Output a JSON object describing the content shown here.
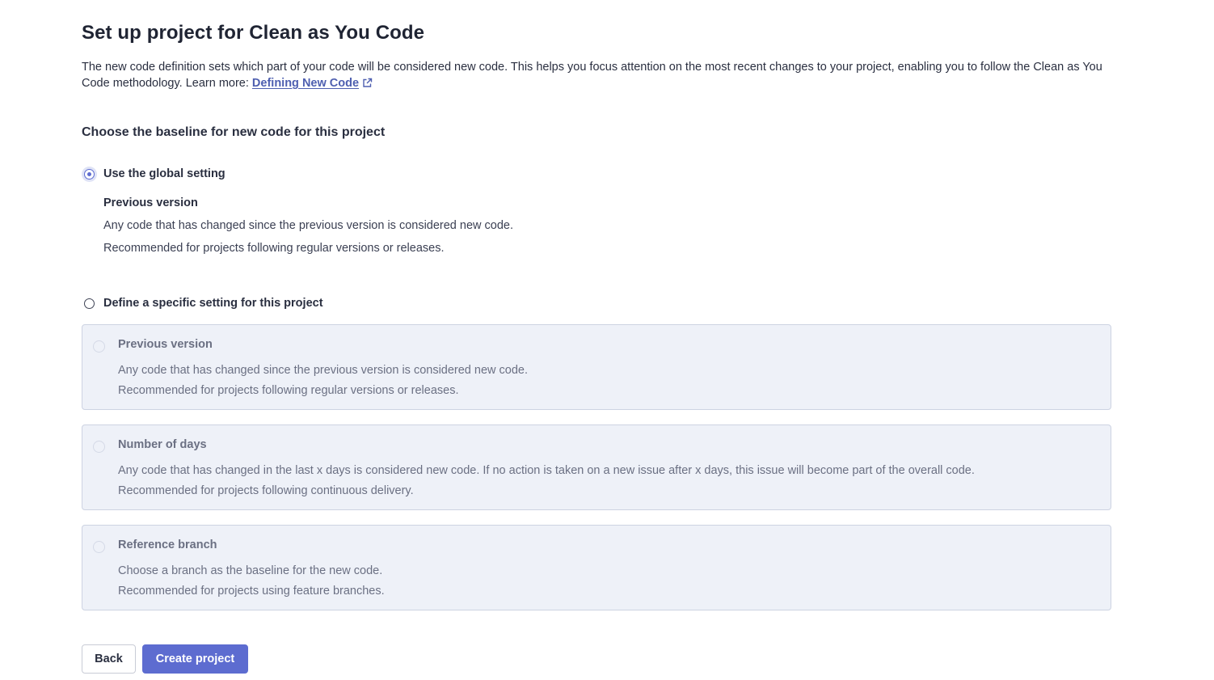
{
  "page": {
    "title": "Set up project for Clean as You Code",
    "intro_text": "The new code definition sets which part of your code will be considered new code. This helps you focus attention on the most recent changes to your project, enabling you to follow the Clean as You Code methodology. Learn more: ",
    "learn_more_link": "Defining New Code",
    "section_heading": "Choose the baseline for new code for this project"
  },
  "global_option": {
    "label": "Use the global setting",
    "selected": true,
    "setting_title": "Previous version",
    "description": "Any code that has changed since the previous version is considered new code.",
    "recommendation": "Recommended for projects following regular versions or releases."
  },
  "specific_option": {
    "label": "Define a specific setting for this project",
    "selected": false,
    "choices": [
      {
        "title": "Previous version",
        "description": "Any code that has changed since the previous version is considered new code.",
        "recommendation": "Recommended for projects following regular versions or releases."
      },
      {
        "title": "Number of days",
        "description": "Any code that has changed in the last x days is considered new code. If no action is taken on a new issue after x days, this issue will become part of the overall code.",
        "recommendation": "Recommended for projects following continuous delivery."
      },
      {
        "title": "Reference branch",
        "description": "Choose a branch as the baseline for the new code.",
        "recommendation": "Recommended for projects using feature branches."
      }
    ]
  },
  "actions": {
    "back_label": "Back",
    "create_label": "Create project"
  },
  "colors": {
    "primary": "#5d6cd0",
    "link": "#4e5fb0",
    "card_background": "#eef1f8",
    "card_border": "#cdd3e2"
  },
  "icons": {
    "external_link": "external-link-icon"
  }
}
